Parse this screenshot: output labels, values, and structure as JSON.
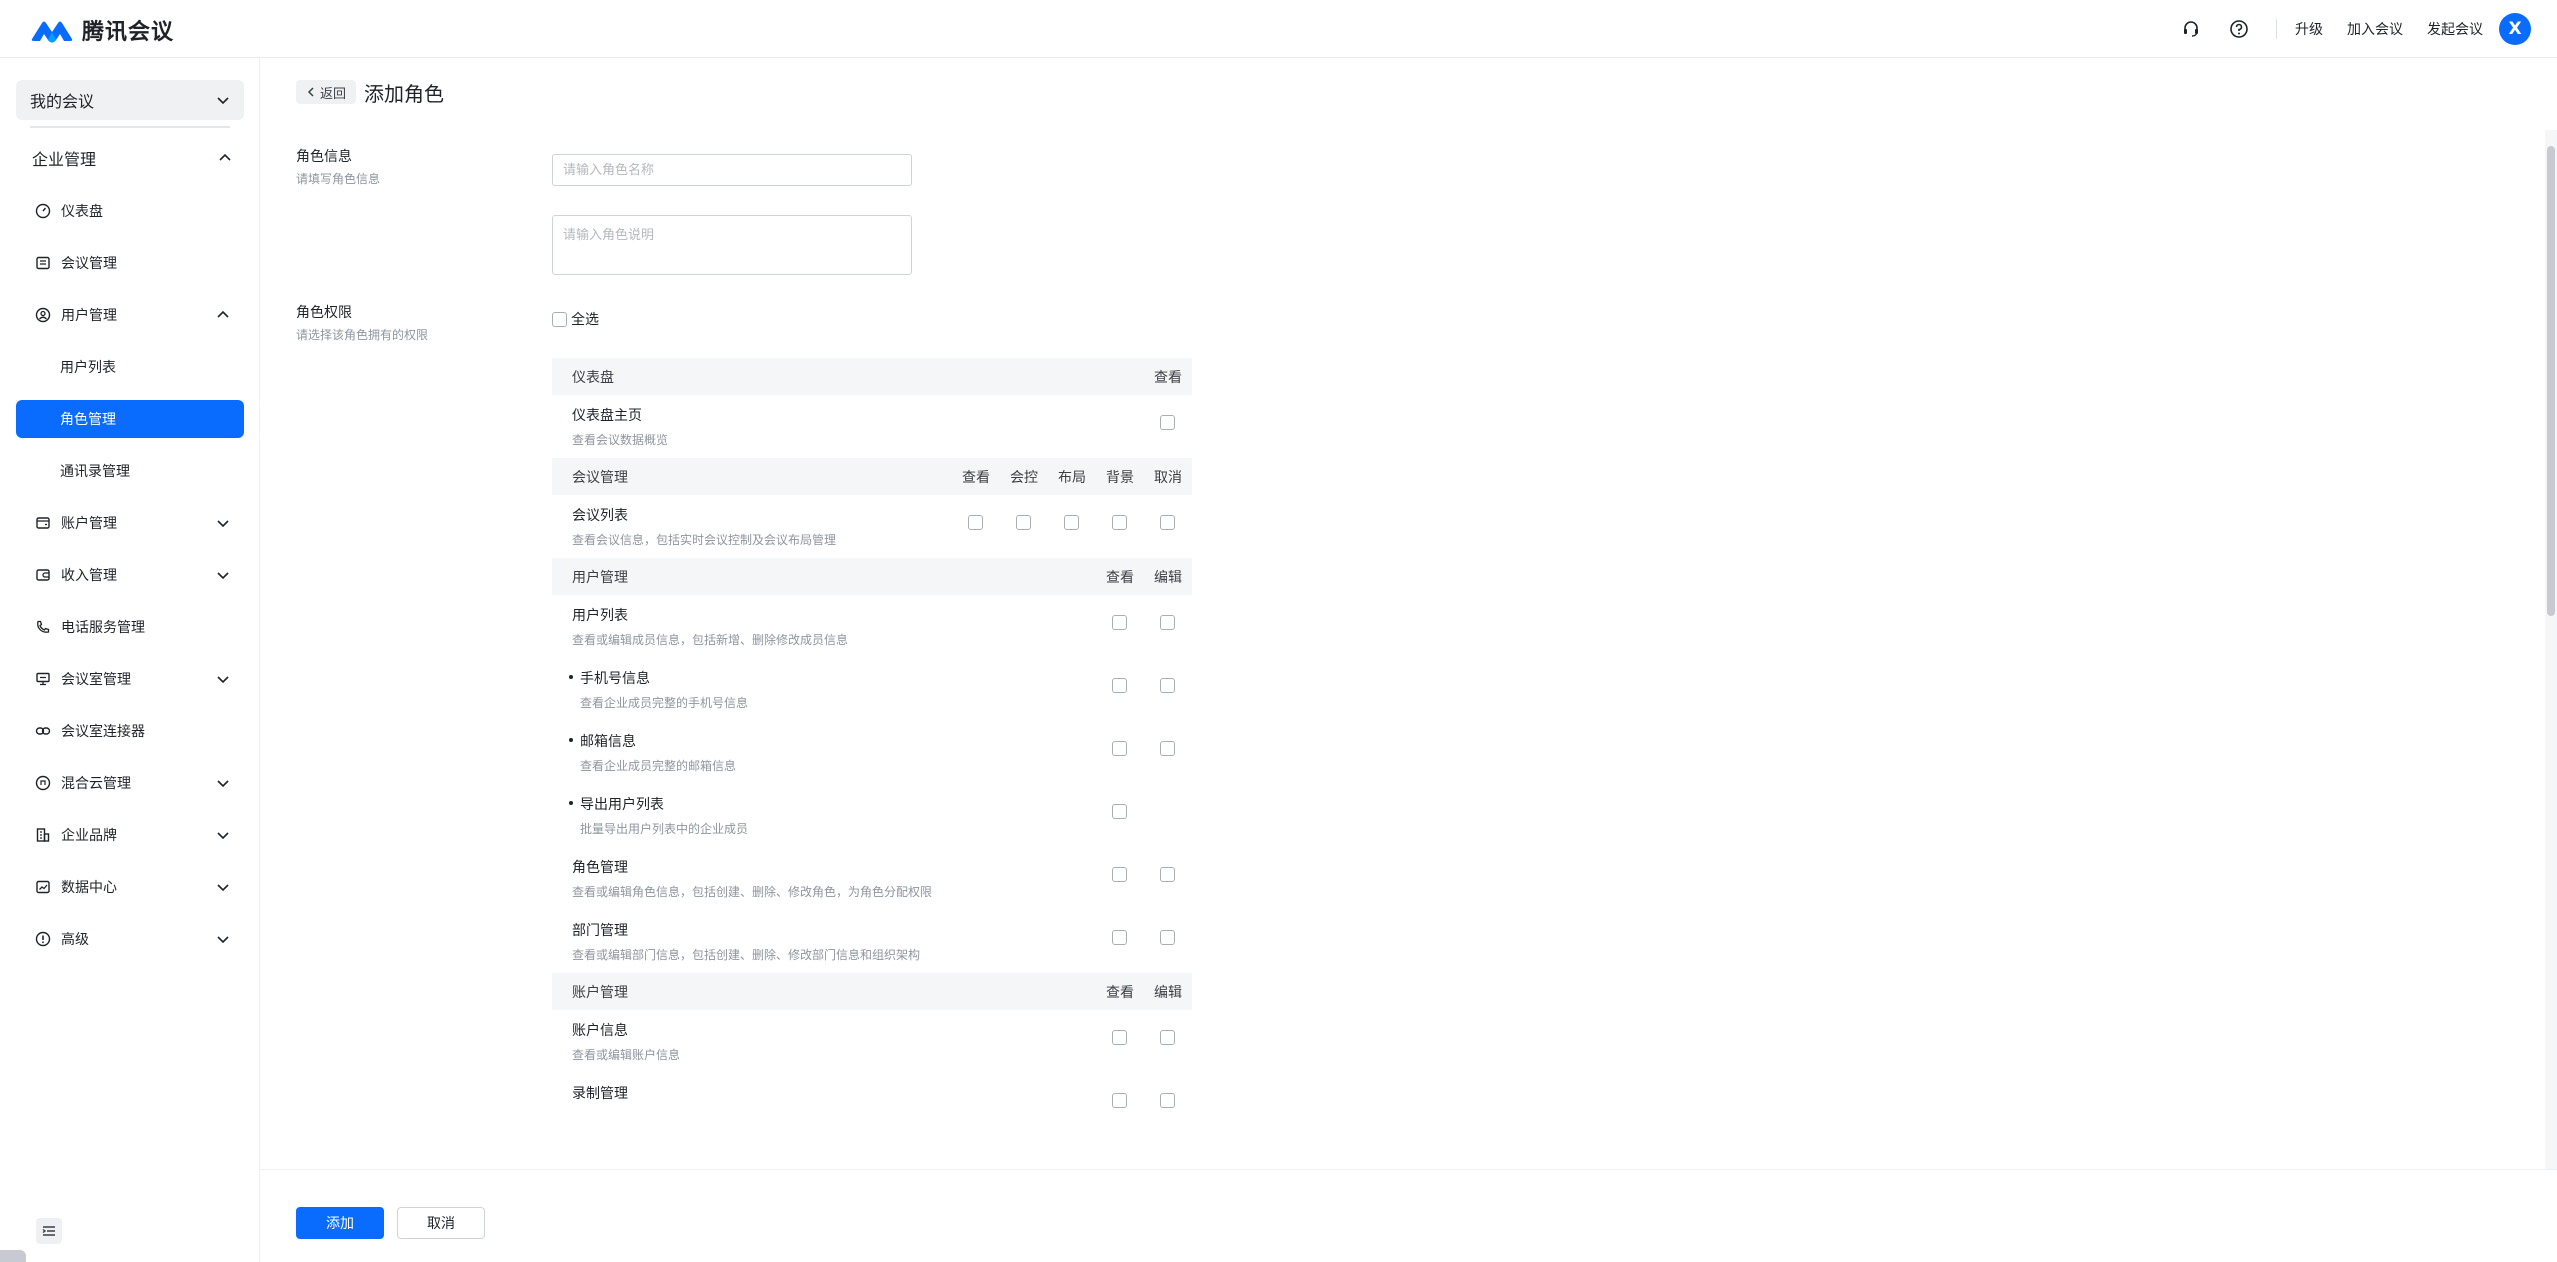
{
  "app": {
    "name": "腾讯会议",
    "brand_color": "#0a6cff"
  },
  "topbar": {
    "links": [
      "升级",
      "加入会议",
      "发起会议"
    ],
    "avatar": "X",
    "icons": [
      "headset-icon",
      "help-icon"
    ]
  },
  "sidebar": {
    "my_meeting": "我的会议",
    "group": "企业管理",
    "items": [
      {
        "label": "仪表盘",
        "icon": "dashboard-icon",
        "chevron": ""
      },
      {
        "label": "会议管理",
        "icon": "list-icon",
        "chevron": ""
      },
      {
        "label": "用户管理",
        "icon": "user-icon",
        "chevron": "up"
      },
      {
        "label": "用户列表",
        "icon": "",
        "chevron": "",
        "sub": true
      },
      {
        "label": "角色管理",
        "icon": "",
        "chevron": "",
        "sub": true,
        "active": true
      },
      {
        "label": "通讯录管理",
        "icon": "",
        "chevron": "",
        "sub": true
      },
      {
        "label": "账户管理",
        "icon": "wallet-icon",
        "chevron": "down"
      },
      {
        "label": "收入管理",
        "icon": "income-icon",
        "chevron": "down"
      },
      {
        "label": "电话服务管理",
        "icon": "phone-icon",
        "chevron": ""
      },
      {
        "label": "会议室管理",
        "icon": "room-icon",
        "chevron": "down"
      },
      {
        "label": "会议室连接器",
        "icon": "link-icon",
        "chevron": ""
      },
      {
        "label": "混合云管理",
        "icon": "cloud-icon",
        "chevron": "down"
      },
      {
        "label": "企业品牌",
        "icon": "building-icon",
        "chevron": "down"
      },
      {
        "label": "数据中心",
        "icon": "chart-icon",
        "chevron": "down"
      },
      {
        "label": "高级",
        "icon": "advanced-icon",
        "chevron": "down"
      }
    ]
  },
  "page": {
    "back": "返回",
    "title": "添加角色",
    "role_info": {
      "title": "角色信息",
      "sub": "请填写角色信息",
      "name_placeholder": "请输入角色名称",
      "desc_placeholder": "请输入角色说明"
    },
    "role_perm": {
      "title": "角色权限",
      "sub": "请选择该角色拥有的权限",
      "select_all": "全选"
    },
    "sections": [
      {
        "name": "仪表盘",
        "columns": [
          "查看"
        ],
        "rows": [
          {
            "title": "仪表盘主页",
            "desc": "查看会议数据概览",
            "checks": [
              true
            ]
          }
        ]
      },
      {
        "name": "会议管理",
        "columns": [
          "查看",
          "会控",
          "布局",
          "背景",
          "取消"
        ],
        "rows": [
          {
            "title": "会议列表",
            "desc": "查看会议信息，包括实时会议控制及会议布局管理",
            "checks": [
              true,
              true,
              true,
              true,
              true
            ]
          }
        ]
      },
      {
        "name": "用户管理",
        "columns": [
          "查看",
          "编辑"
        ],
        "rows": [
          {
            "title": "用户列表",
            "desc": "查看或编辑成员信息，包括新增、删除修改成员信息",
            "checks": [
              true,
              true
            ]
          },
          {
            "title": "手机号信息",
            "desc": "查看企业成员完整的手机号信息",
            "checks": [
              true,
              true
            ],
            "bullet": true
          },
          {
            "title": "邮箱信息",
            "desc": "查看企业成员完整的邮箱信息",
            "checks": [
              true,
              true
            ],
            "bullet": true
          },
          {
            "title": "导出用户列表",
            "desc": "批量导出用户列表中的企业成员",
            "checks": [
              true,
              false
            ],
            "bullet": true
          },
          {
            "title": "角色管理",
            "desc": "查看或编辑角色信息，包括创建、删除、修改角色，为角色分配权限",
            "checks": [
              true,
              true
            ]
          },
          {
            "title": "部门管理",
            "desc": "查看或编辑部门信息，包括创建、删除、修改部门信息和组织架构",
            "checks": [
              true,
              true
            ]
          }
        ]
      },
      {
        "name": "账户管理",
        "columns": [
          "查看",
          "编辑"
        ],
        "rows": [
          {
            "title": "账户信息",
            "desc": "查看或编辑账户信息",
            "checks": [
              true,
              true
            ]
          },
          {
            "title": "录制管理",
            "desc": "",
            "checks": [
              true,
              true
            ]
          }
        ]
      }
    ],
    "footer": {
      "add": "添加",
      "cancel": "取消"
    }
  }
}
